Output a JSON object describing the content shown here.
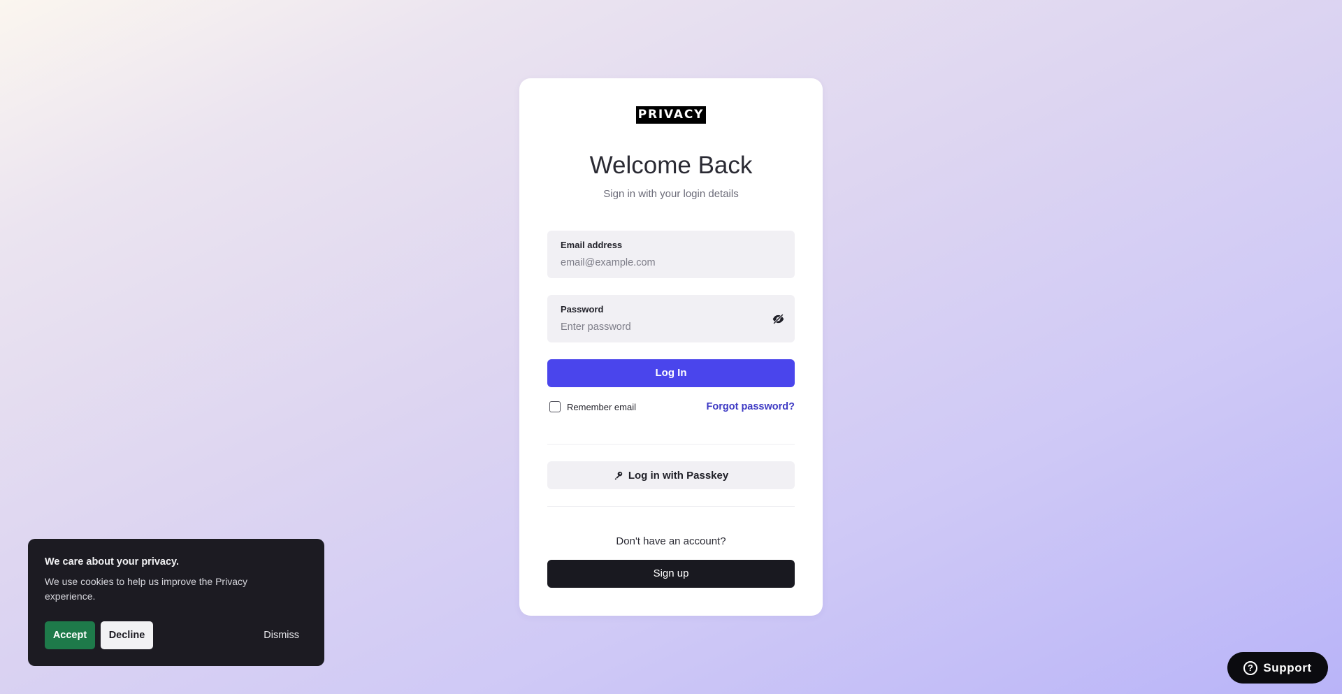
{
  "brand": {
    "logo_text": "PRIVACY"
  },
  "login": {
    "title": "Welcome Back",
    "subtitle": "Sign in with your login details",
    "email_label": "Email address",
    "email_placeholder": "email@example.com",
    "password_label": "Password",
    "password_placeholder": "Enter password",
    "password_toggle_icon": "eye-off-icon",
    "login_button": "Log In",
    "remember_label": "Remember email",
    "remember_checked": false,
    "forgot_link": "Forgot password?",
    "passkey_icon": "key-icon",
    "passkey_button": "Log in with Passkey",
    "no_account_text": "Don't have an account?",
    "signup_button": "Sign up"
  },
  "cookie_banner": {
    "title": "We care about your privacy.",
    "text": "We use cookies to help us improve the Privacy experience.",
    "accept": "Accept",
    "decline": "Decline",
    "dismiss": "Dismiss"
  },
  "support": {
    "icon": "help-circle-icon",
    "label": "Support"
  },
  "colors": {
    "primary": "#4a45ec",
    "link": "#3e3ac4",
    "signup_bg": "#191920",
    "accept_bg": "#1e7a4a",
    "banner_bg": "#1c1b22"
  }
}
